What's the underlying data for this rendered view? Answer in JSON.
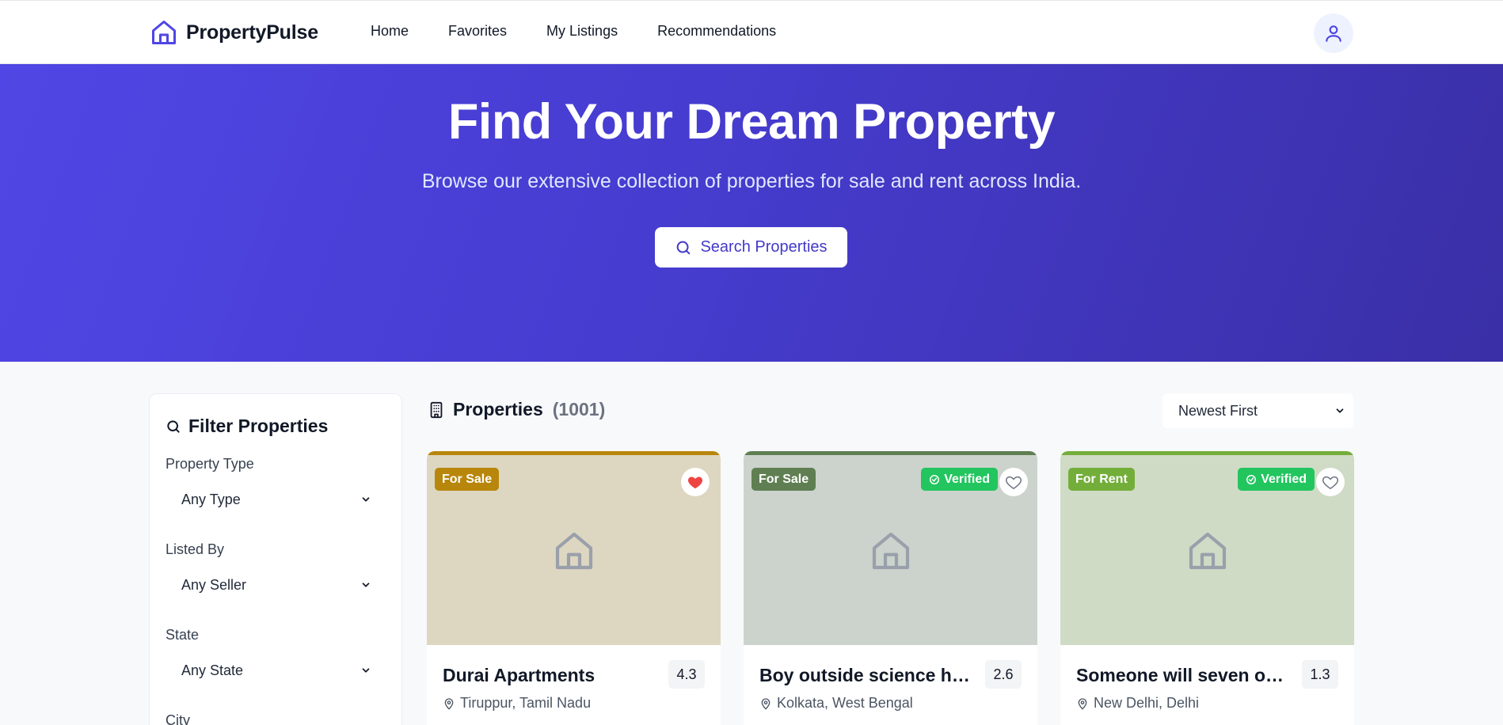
{
  "nav": {
    "brand": "PropertyPulse",
    "links": [
      "Home",
      "Favorites",
      "My Listings",
      "Recommendations"
    ]
  },
  "hero": {
    "title": "Find Your Dream Property",
    "subtitle": "Browse our extensive collection of properties for sale and rent across India.",
    "button": "Search Properties"
  },
  "filter": {
    "title": "Filter Properties",
    "fields": [
      {
        "label": "Property Type",
        "value": "Any Type"
      },
      {
        "label": "Listed By",
        "value": "Any Seller"
      },
      {
        "label": "State",
        "value": "Any State"
      },
      {
        "label": "City",
        "value": ""
      }
    ]
  },
  "listing": {
    "title": "Properties",
    "count": "(1001)",
    "sort": "Newest First"
  },
  "cards": [
    {
      "type": "For Sale",
      "verified": "",
      "title": "Durai Apartments",
      "rating": "4.3",
      "location": "Tiruppur, Tamil Nadu",
      "favorited": true,
      "accent": "#b8860b",
      "bg": "#ddd6c1",
      "badge_color": "#b8860b"
    },
    {
      "type": "For Sale",
      "verified": "Verified",
      "title": "Boy outside science house",
      "rating": "2.6",
      "location": "Kolkata, West Bengal",
      "favorited": false,
      "accent": "#5f7f52",
      "bg": "#ccd3cc",
      "badge_color": "#5f7f52"
    },
    {
      "type": "For Rent",
      "verified": "Verified",
      "title": "Someone will seven onto",
      "rating": "1.3",
      "location": "New Delhi, Delhi",
      "favorited": false,
      "accent": "#73ae3a",
      "bg": "#d0dbc6",
      "badge_color": "#73ae3a"
    }
  ],
  "colors": {
    "primary": "#4f46e5",
    "heart_red": "#ef4444",
    "verified_green": "#22c55e"
  }
}
